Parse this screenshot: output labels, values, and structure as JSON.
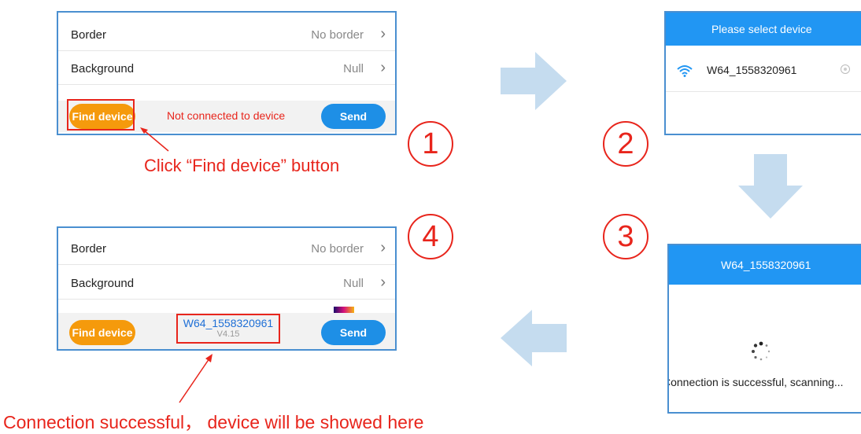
{
  "colors": {
    "accent_blue": "#2196f3",
    "orange": "#f59a0c",
    "red": "#e8251c",
    "arrow_blue": "#c5dcef"
  },
  "panel1": {
    "rows": [
      {
        "label": "Border",
        "value": "No border"
      },
      {
        "label": "Background",
        "value": "Null"
      }
    ],
    "find_button": "Find device",
    "status": "Not connected to device",
    "send_button": "Send"
  },
  "step1": {
    "number": "1",
    "annotation": "Click “Find device” button"
  },
  "dialog2": {
    "title": "Please select device",
    "device_name": "W64_1558320961",
    "icon": "wifi-icon"
  },
  "step2": {
    "number": "2"
  },
  "step3": {
    "number": "3"
  },
  "dialog3": {
    "title": "W64_1558320961",
    "message": "Connection is successful, scanning...",
    "icon": "spinner-icon"
  },
  "step4": {
    "number": "4"
  },
  "panel4": {
    "rows": [
      {
        "label": "Border",
        "value": "No border"
      },
      {
        "label": "Background",
        "value": "Null"
      }
    ],
    "find_button": "Find device",
    "device_name": "W64_1558320961",
    "device_version": "V4.15",
    "send_button": "Send"
  },
  "annotation_bottom": "Connection successful， device will be showed here"
}
